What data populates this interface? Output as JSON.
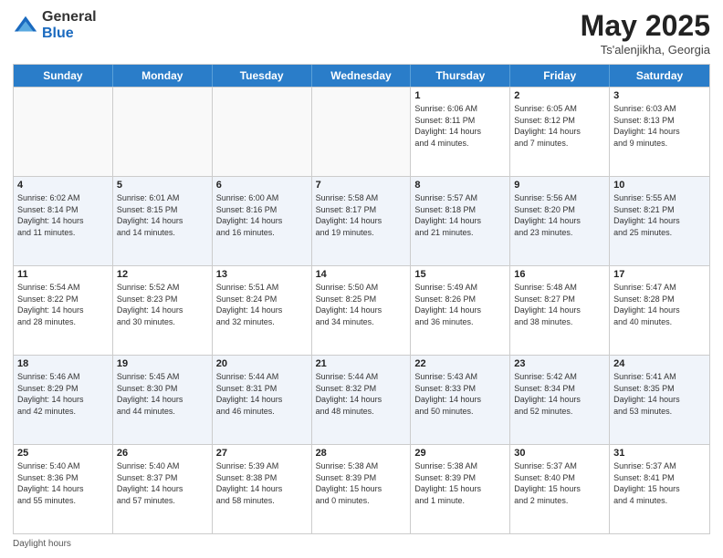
{
  "logo": {
    "general": "General",
    "blue": "Blue"
  },
  "title": {
    "month": "May 2025",
    "location": "Ts'alenjikha, Georgia"
  },
  "header_days": [
    "Sunday",
    "Monday",
    "Tuesday",
    "Wednesday",
    "Thursday",
    "Friday",
    "Saturday"
  ],
  "footer": "Daylight hours",
  "weeks": [
    [
      {
        "day": "",
        "info": ""
      },
      {
        "day": "",
        "info": ""
      },
      {
        "day": "",
        "info": ""
      },
      {
        "day": "",
        "info": ""
      },
      {
        "day": "1",
        "info": "Sunrise: 6:06 AM\nSunset: 8:11 PM\nDaylight: 14 hours\nand 4 minutes."
      },
      {
        "day": "2",
        "info": "Sunrise: 6:05 AM\nSunset: 8:12 PM\nDaylight: 14 hours\nand 7 minutes."
      },
      {
        "day": "3",
        "info": "Sunrise: 6:03 AM\nSunset: 8:13 PM\nDaylight: 14 hours\nand 9 minutes."
      }
    ],
    [
      {
        "day": "4",
        "info": "Sunrise: 6:02 AM\nSunset: 8:14 PM\nDaylight: 14 hours\nand 11 minutes."
      },
      {
        "day": "5",
        "info": "Sunrise: 6:01 AM\nSunset: 8:15 PM\nDaylight: 14 hours\nand 14 minutes."
      },
      {
        "day": "6",
        "info": "Sunrise: 6:00 AM\nSunset: 8:16 PM\nDaylight: 14 hours\nand 16 minutes."
      },
      {
        "day": "7",
        "info": "Sunrise: 5:58 AM\nSunset: 8:17 PM\nDaylight: 14 hours\nand 19 minutes."
      },
      {
        "day": "8",
        "info": "Sunrise: 5:57 AM\nSunset: 8:18 PM\nDaylight: 14 hours\nand 21 minutes."
      },
      {
        "day": "9",
        "info": "Sunrise: 5:56 AM\nSunset: 8:20 PM\nDaylight: 14 hours\nand 23 minutes."
      },
      {
        "day": "10",
        "info": "Sunrise: 5:55 AM\nSunset: 8:21 PM\nDaylight: 14 hours\nand 25 minutes."
      }
    ],
    [
      {
        "day": "11",
        "info": "Sunrise: 5:54 AM\nSunset: 8:22 PM\nDaylight: 14 hours\nand 28 minutes."
      },
      {
        "day": "12",
        "info": "Sunrise: 5:52 AM\nSunset: 8:23 PM\nDaylight: 14 hours\nand 30 minutes."
      },
      {
        "day": "13",
        "info": "Sunrise: 5:51 AM\nSunset: 8:24 PM\nDaylight: 14 hours\nand 32 minutes."
      },
      {
        "day": "14",
        "info": "Sunrise: 5:50 AM\nSunset: 8:25 PM\nDaylight: 14 hours\nand 34 minutes."
      },
      {
        "day": "15",
        "info": "Sunrise: 5:49 AM\nSunset: 8:26 PM\nDaylight: 14 hours\nand 36 minutes."
      },
      {
        "day": "16",
        "info": "Sunrise: 5:48 AM\nSunset: 8:27 PM\nDaylight: 14 hours\nand 38 minutes."
      },
      {
        "day": "17",
        "info": "Sunrise: 5:47 AM\nSunset: 8:28 PM\nDaylight: 14 hours\nand 40 minutes."
      }
    ],
    [
      {
        "day": "18",
        "info": "Sunrise: 5:46 AM\nSunset: 8:29 PM\nDaylight: 14 hours\nand 42 minutes."
      },
      {
        "day": "19",
        "info": "Sunrise: 5:45 AM\nSunset: 8:30 PM\nDaylight: 14 hours\nand 44 minutes."
      },
      {
        "day": "20",
        "info": "Sunrise: 5:44 AM\nSunset: 8:31 PM\nDaylight: 14 hours\nand 46 minutes."
      },
      {
        "day": "21",
        "info": "Sunrise: 5:44 AM\nSunset: 8:32 PM\nDaylight: 14 hours\nand 48 minutes."
      },
      {
        "day": "22",
        "info": "Sunrise: 5:43 AM\nSunset: 8:33 PM\nDaylight: 14 hours\nand 50 minutes."
      },
      {
        "day": "23",
        "info": "Sunrise: 5:42 AM\nSunset: 8:34 PM\nDaylight: 14 hours\nand 52 minutes."
      },
      {
        "day": "24",
        "info": "Sunrise: 5:41 AM\nSunset: 8:35 PM\nDaylight: 14 hours\nand 53 minutes."
      }
    ],
    [
      {
        "day": "25",
        "info": "Sunrise: 5:40 AM\nSunset: 8:36 PM\nDaylight: 14 hours\nand 55 minutes."
      },
      {
        "day": "26",
        "info": "Sunrise: 5:40 AM\nSunset: 8:37 PM\nDaylight: 14 hours\nand 57 minutes."
      },
      {
        "day": "27",
        "info": "Sunrise: 5:39 AM\nSunset: 8:38 PM\nDaylight: 14 hours\nand 58 minutes."
      },
      {
        "day": "28",
        "info": "Sunrise: 5:38 AM\nSunset: 8:39 PM\nDaylight: 15 hours\nand 0 minutes."
      },
      {
        "day": "29",
        "info": "Sunrise: 5:38 AM\nSunset: 8:39 PM\nDaylight: 15 hours\nand 1 minute."
      },
      {
        "day": "30",
        "info": "Sunrise: 5:37 AM\nSunset: 8:40 PM\nDaylight: 15 hours\nand 2 minutes."
      },
      {
        "day": "31",
        "info": "Sunrise: 5:37 AM\nSunset: 8:41 PM\nDaylight: 15 hours\nand 4 minutes."
      }
    ]
  ]
}
